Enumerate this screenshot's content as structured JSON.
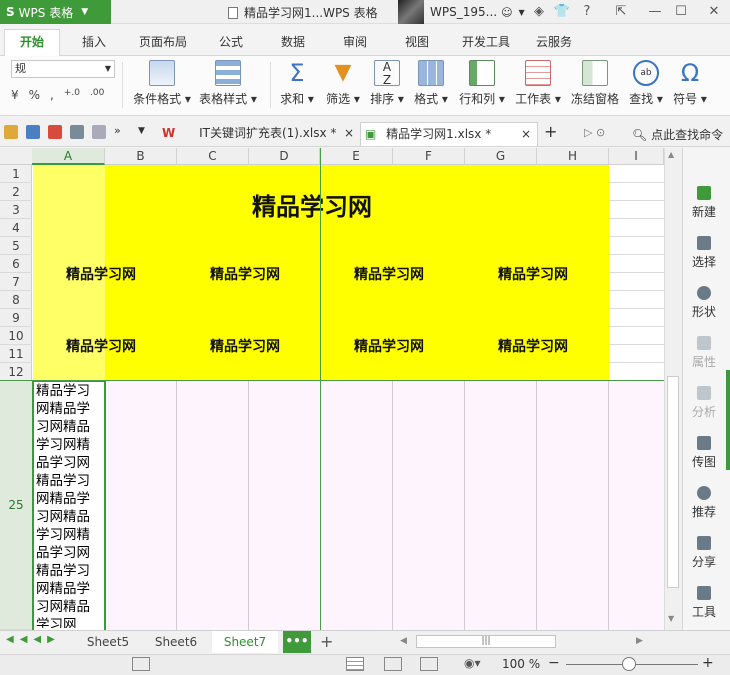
{
  "titlebar": {
    "app_name": "WPS 表格",
    "doc_title": "精品学习网1...WPS 表格",
    "user_name": "WPS_195..."
  },
  "menu": {
    "tabs": [
      "开始",
      "插入",
      "页面布局",
      "公式",
      "数据",
      "审阅",
      "视图",
      "开发工具",
      "云服务"
    ],
    "active": "开始"
  },
  "ribbon": {
    "font_name": "规",
    "buttons": [
      "条件格式",
      "表格样式",
      "求和",
      "筛选",
      "排序",
      "格式",
      "行和列",
      "工作表",
      "冻结窗格",
      "查找",
      "符号"
    ],
    "labels_with_dropdown": [
      "条件格式 ▾",
      "表格样式 ▾",
      "求和 ▾",
      "筛选 ▾",
      "排序 ▾",
      "格式 ▾",
      "行和列 ▾",
      "工作表 ▾",
      "冻结窗格",
      "查找 ▾",
      "符号 ▾"
    ],
    "small_row": [
      "%",
      ","
    ]
  },
  "doctabs": {
    "tabs": [
      "IT关键词扩充表(1).xlsx *",
      "精品学习网1.xlsx *"
    ],
    "active_index": 1,
    "find_cmd": "点此查找命令"
  },
  "sheet": {
    "columns": [
      "A",
      "B",
      "C",
      "D",
      "E",
      "F",
      "G",
      "H",
      "I"
    ],
    "selected_column": "A",
    "rows": [
      "1",
      "2",
      "3",
      "4",
      "5",
      "6",
      "7",
      "8",
      "9",
      "10",
      "11",
      "12",
      "25"
    ],
    "selected_row": "25",
    "title": "精品学习网",
    "row6_8_text": [
      "精品学习网",
      "精品学习网",
      "精品学习网",
      "精品学习网"
    ],
    "row10_11_text": [
      "精品学习网",
      "精品学习网",
      "精品学习网",
      "精品学习网"
    ],
    "cell_a25": "精品学习网精品学习网精品学习网精品学习网精品学习网精品学习网精品学习网精品学习网精品学习网精品学习网精品学习网",
    "highlight_color": "#ffff00"
  },
  "task_pane": {
    "items": [
      "新建",
      "选择",
      "形状",
      "属性",
      "分析",
      "传图",
      "推荐",
      "分享",
      "工具"
    ]
  },
  "sheet_tabs": {
    "tabs": [
      "Sheet5",
      "Sheet6",
      "Sheet7"
    ],
    "active": "Sheet7",
    "more": "•••",
    "add": "+"
  },
  "statusbar": {
    "zoom": "100 %"
  },
  "colors": {
    "accent": "#3f9a3a",
    "yellow": "#ffff00",
    "pink": "#fdf4fd"
  }
}
